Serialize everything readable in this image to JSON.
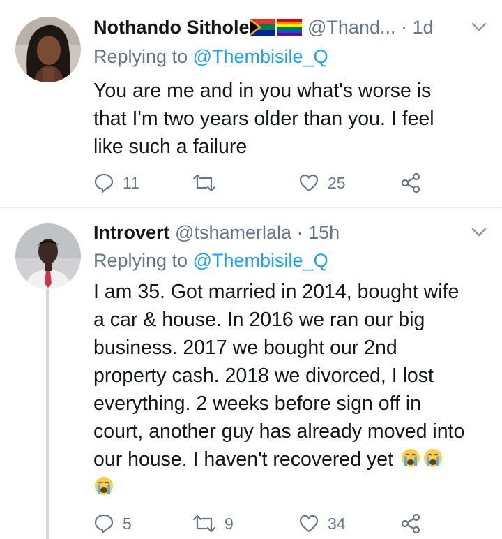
{
  "tweets": [
    {
      "name": "Nothando Sithole",
      "handle": "@Thand...",
      "separator": "·",
      "time": "1d",
      "replying_prefix": "Replying to",
      "replying_mention": "@Thembisile_Q",
      "body_lines": [
        "You are me and in you what's worse is",
        "that I'm two years older than you. I feel",
        "like such a failure"
      ],
      "reply_count": "11",
      "retweet_count": "",
      "like_count": "25",
      "colors": {
        "accent": "#1da1f2",
        "muted": "#657786"
      }
    },
    {
      "name": "Introvert",
      "handle": "@tshamerlala",
      "separator": "·",
      "time": "15h",
      "replying_prefix": "Replying to",
      "replying_mention": "@Thembisile_Q",
      "body_lines": [
        "I am 35. Got married in 2014, bought wife",
        "a car & house. In 2016 we ran our big",
        "business. 2017 we bought our 2nd",
        "property cash. 2018 we divorced, I lost",
        "everything. 2 weeks before sign off in",
        "court, another guy has already moved into",
        "our house. I haven't recovered yet"
      ],
      "emoji": "crying-face",
      "reply_count": "5",
      "retweet_count": "9",
      "like_count": "34"
    }
  ]
}
